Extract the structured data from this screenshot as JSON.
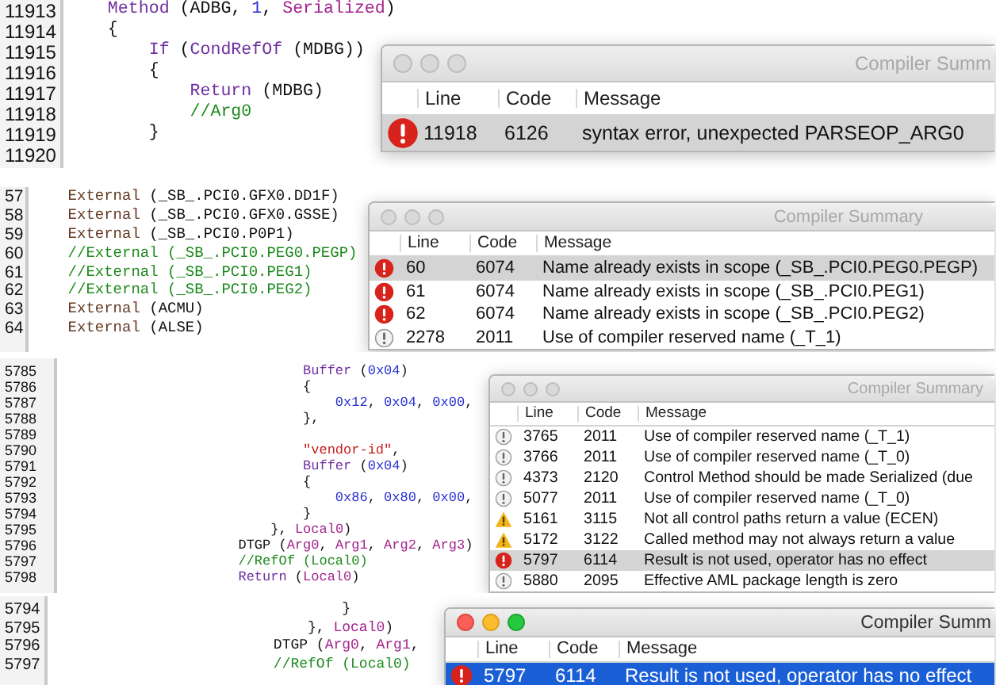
{
  "panels": [
    {
      "code_lines": [
        {
          "number": "11913",
          "tokens": [
            {
              "kind": "keyword",
              "text": "    Method"
            },
            {
              "kind": "plain",
              "text": " (ADBG, "
            },
            {
              "kind": "number",
              "text": "1"
            },
            {
              "kind": "plain",
              "text": ", "
            },
            {
              "kind": "constant",
              "text": "Serialized"
            },
            {
              "kind": "plain",
              "text": ")"
            }
          ]
        },
        {
          "number": "11914",
          "tokens": [
            {
              "kind": "plain",
              "text": "    {"
            }
          ]
        },
        {
          "number": "11915",
          "tokens": [
            {
              "kind": "keyword",
              "text": "        If"
            },
            {
              "kind": "plain",
              "text": " ("
            },
            {
              "kind": "keyword",
              "text": "CondRefOf"
            },
            {
              "kind": "plain",
              "text": " (MDBG))"
            }
          ]
        },
        {
          "number": "11916",
          "tokens": [
            {
              "kind": "plain",
              "text": "        {"
            }
          ]
        },
        {
          "number": "11917",
          "tokens": [
            {
              "kind": "keyword",
              "text": "            Return"
            },
            {
              "kind": "plain",
              "text": " (MDBG)"
            }
          ]
        },
        {
          "number": "11918",
          "tokens": [
            {
              "kind": "comment",
              "text": "            //Arg0"
            }
          ]
        },
        {
          "number": "11919",
          "tokens": [
            {
              "kind": "plain",
              "text": "        }"
            }
          ]
        },
        {
          "number": "11920"
        }
      ],
      "window": {
        "title": "Compiler Summ",
        "active": false,
        "columns": [
          "Line",
          "Code",
          "Message"
        ],
        "rows": [
          {
            "kind": "error",
            "line": "11918",
            "code": "6126",
            "message": "syntax error, unexpected PARSEOP_ARG0",
            "selected": true
          }
        ]
      }
    },
    {
      "code_lines": [
        {
          "number": "57",
          "tokens": [
            {
              "kind": "external",
              "text": "    External"
            },
            {
              "kind": "plain",
              "text": " (_SB_.PCI0.GFX0.DD1F)"
            }
          ]
        },
        {
          "number": "58",
          "tokens": [
            {
              "kind": "external",
              "text": "    External"
            },
            {
              "kind": "plain",
              "text": " (_SB_.PCI0.GFX0.GSSE)"
            }
          ]
        },
        {
          "number": "59",
          "tokens": [
            {
              "kind": "external",
              "text": "    External"
            },
            {
              "kind": "plain",
              "text": " (_SB_.PCI0.P0P1)"
            }
          ]
        },
        {
          "number": "60",
          "tokens": [
            {
              "kind": "comment",
              "text": "    //External (_SB_.PCI0.PEG0.PEGP)"
            }
          ]
        },
        {
          "number": "61",
          "tokens": [
            {
              "kind": "comment",
              "text": "    //External (_SB_.PCI0.PEG1)"
            }
          ]
        },
        {
          "number": "62",
          "tokens": [
            {
              "kind": "comment",
              "text": "    //External (_SB_.PCI0.PEG2)"
            }
          ]
        },
        {
          "number": "63",
          "tokens": [
            {
              "kind": "external",
              "text": "    External"
            },
            {
              "kind": "plain",
              "text": " (ACMU)"
            }
          ]
        },
        {
          "number": "64",
          "tokens": [
            {
              "kind": "external",
              "text": "    External"
            },
            {
              "kind": "plain",
              "text": " (ALSE)"
            }
          ]
        }
      ],
      "window": {
        "title": "Compiler Summary",
        "active": false,
        "columns": [
          "Line",
          "Code",
          "Message"
        ],
        "rows": [
          {
            "kind": "error",
            "line": "60",
            "code": "6074",
            "message": "Name already exists in scope (_SB_.PCI0.PEG0.PEGP)",
            "selected": true
          },
          {
            "kind": "error",
            "line": "61",
            "code": "6074",
            "message": "Name already exists in scope (_SB_.PCI0.PEG1)",
            "selected": false
          },
          {
            "kind": "error",
            "line": "62",
            "code": "6074",
            "message": "Name already exists in scope (_SB_.PCI0.PEG2)",
            "selected": false
          },
          {
            "kind": "remark",
            "line": "2278",
            "code": "2011",
            "message": "Use of compiler reserved name (_T_1)",
            "selected": false
          }
        ]
      }
    },
    {
      "code_lines": [
        {
          "number": "5785",
          "tokens": [
            {
              "kind": "keyword",
              "text": "                              Buffer"
            },
            {
              "kind": "plain",
              "text": " ("
            },
            {
              "kind": "number",
              "text": "0x04"
            },
            {
              "kind": "plain",
              "text": ")"
            }
          ]
        },
        {
          "number": "5786",
          "tokens": [
            {
              "kind": "plain",
              "text": "                              {"
            }
          ]
        },
        {
          "number": "5787",
          "tokens": [
            {
              "kind": "number",
              "text": "                                  0x12"
            },
            {
              "kind": "plain",
              "text": ", "
            },
            {
              "kind": "number",
              "text": "0x04"
            },
            {
              "kind": "plain",
              "text": ", "
            },
            {
              "kind": "number",
              "text": "0x00"
            },
            {
              "kind": "plain",
              "text": ","
            }
          ]
        },
        {
          "number": "5788",
          "tokens": [
            {
              "kind": "plain",
              "text": "                              },"
            }
          ]
        },
        {
          "number": "5789"
        },
        {
          "number": "5790",
          "tokens": [
            {
              "kind": "string",
              "text": "                              \"vendor-id\""
            },
            {
              "kind": "plain",
              "text": ","
            }
          ]
        },
        {
          "number": "5791",
          "tokens": [
            {
              "kind": "keyword",
              "text": "                              Buffer"
            },
            {
              "kind": "plain",
              "text": " ("
            },
            {
              "kind": "number",
              "text": "0x04"
            },
            {
              "kind": "plain",
              "text": ")"
            }
          ]
        },
        {
          "number": "5792",
          "tokens": [
            {
              "kind": "plain",
              "text": "                              {"
            }
          ]
        },
        {
          "number": "5793",
          "tokens": [
            {
              "kind": "number",
              "text": "                                  0x86"
            },
            {
              "kind": "plain",
              "text": ", "
            },
            {
              "kind": "number",
              "text": "0x80"
            },
            {
              "kind": "plain",
              "text": ", "
            },
            {
              "kind": "number",
              "text": "0x00"
            },
            {
              "kind": "plain",
              "text": ","
            }
          ]
        },
        {
          "number": "5794",
          "tokens": [
            {
              "kind": "plain",
              "text": "                              }"
            }
          ]
        },
        {
          "number": "5795",
          "tokens": [
            {
              "kind": "plain",
              "text": "                          }, "
            },
            {
              "kind": "constant",
              "text": "Local0"
            },
            {
              "kind": "plain",
              "text": ")"
            }
          ]
        },
        {
          "number": "5796",
          "tokens": [
            {
              "kind": "plain",
              "text": "                      DTGP ("
            },
            {
              "kind": "constant",
              "text": "Arg0"
            },
            {
              "kind": "plain",
              "text": ", "
            },
            {
              "kind": "constant",
              "text": "Arg1"
            },
            {
              "kind": "plain",
              "text": ", "
            },
            {
              "kind": "constant",
              "text": "Arg2"
            },
            {
              "kind": "plain",
              "text": ", "
            },
            {
              "kind": "constant",
              "text": "Arg3"
            },
            {
              "kind": "plain",
              "text": ")"
            }
          ]
        },
        {
          "number": "5797",
          "tokens": [
            {
              "kind": "comment",
              "text": "                      //RefOf (Local0)"
            }
          ]
        },
        {
          "number": "5798",
          "tokens": [
            {
              "kind": "keyword",
              "text": "                      Return"
            },
            {
              "kind": "plain",
              "text": " ("
            },
            {
              "kind": "constant",
              "text": "Local0"
            },
            {
              "kind": "plain",
              "text": ")"
            }
          ]
        }
      ],
      "window": {
        "title": "Compiler Summary",
        "active": false,
        "columns": [
          "Line",
          "Code",
          "Message"
        ],
        "rows": [
          {
            "kind": "remark",
            "line": "3765",
            "code": "2011",
            "message": "Use of compiler reserved name (_T_1)",
            "selected": false
          },
          {
            "kind": "remark",
            "line": "3766",
            "code": "2011",
            "message": "Use of compiler reserved name (_T_0)",
            "selected": false
          },
          {
            "kind": "remark",
            "line": "4373",
            "code": "2120",
            "message": "Control Method should be made Serialized (due",
            "selected": false
          },
          {
            "kind": "remark",
            "line": "5077",
            "code": "2011",
            "message": "Use of compiler reserved name (_T_0)",
            "selected": false
          },
          {
            "kind": "warning",
            "line": "5161",
            "code": "3115",
            "message": "Not all control paths return a value (ECEN)",
            "selected": false
          },
          {
            "kind": "warning",
            "line": "5172",
            "code": "3122",
            "message": "Called method may not always return a value",
            "selected": false
          },
          {
            "kind": "error",
            "line": "5797",
            "code": "6114",
            "message": "Result is not used, operator has no effect",
            "selected": true
          },
          {
            "kind": "remark",
            "line": "5880",
            "code": "2095",
            "message": "Effective AML package length is zero",
            "selected": false
          }
        ]
      }
    },
    {
      "code_lines": [
        {
          "number": "5794",
          "tokens": [
            {
              "kind": "plain",
              "text": "                                  }"
            }
          ]
        },
        {
          "number": "5795",
          "tokens": [
            {
              "kind": "plain",
              "text": "                              }, "
            },
            {
              "kind": "constant",
              "text": "Local0"
            },
            {
              "kind": "plain",
              "text": ")"
            }
          ]
        },
        {
          "number": "5796",
          "tokens": [
            {
              "kind": "plain",
              "text": "                          DTGP ("
            },
            {
              "kind": "constant",
              "text": "Arg0"
            },
            {
              "kind": "plain",
              "text": ", "
            },
            {
              "kind": "constant",
              "text": "Arg1"
            },
            {
              "kind": "plain",
              "text": ","
            }
          ]
        },
        {
          "number": "5797",
          "tokens": [
            {
              "kind": "comment",
              "text": "                          //RefOf (Local0)"
            }
          ]
        }
      ],
      "window": {
        "title": "Compiler Summ",
        "active": true,
        "columns": [
          "Line",
          "Code",
          "Message"
        ],
        "rows": [
          {
            "kind": "error",
            "line": "5797",
            "code": "6114",
            "message": "Result is not used, operator has no effect",
            "selected": true
          }
        ]
      }
    }
  ]
}
